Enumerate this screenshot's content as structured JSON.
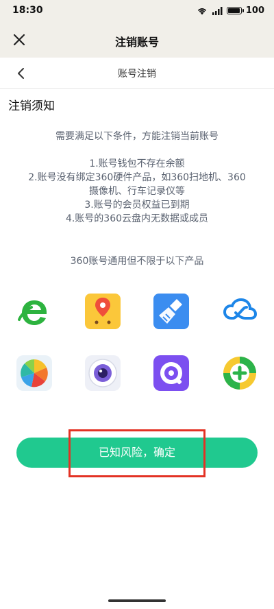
{
  "status_bar": {
    "time": "18:30",
    "battery": "100",
    "battery_level": 1.0,
    "icons": [
      "wifi-icon",
      "signal-icon",
      "battery-icon"
    ]
  },
  "title_bar": {
    "title": "注销账号",
    "close_icon": "close-icon"
  },
  "inner_nav": {
    "title": "账号注销",
    "back_icon": "chevron-left-icon"
  },
  "notice": {
    "section_title": "注销须知",
    "intro": "需要满足以下条件，方能注销当前账号",
    "conditions": [
      "1.账号钱包不存在余额",
      "2.账号没有绑定360硬件产品，如360扫地机、360",
      "摄像机、行车记录仪等",
      "3.账号的会员权益已到期",
      "4.账号的360云盘内无数据或成员"
    ],
    "products_intro": "360账号通用但不限于以下产品"
  },
  "products": [
    {
      "name": "browser-e-icon"
    },
    {
      "name": "map-pin-app-icon"
    },
    {
      "name": "broom-cleaner-icon"
    },
    {
      "name": "cloud-disk-icon"
    },
    {
      "name": "color-segment-app-icon"
    },
    {
      "name": "camera-app-icon"
    },
    {
      "name": "purple-ring-app-icon"
    },
    {
      "name": "security-plus-icon"
    }
  ],
  "confirm_button": {
    "label": "已知风险，确定"
  },
  "colors": {
    "accent": "#20c98f",
    "highlight": "#e33224",
    "header_bg": "#f1efe9",
    "notice_text": "#5a6270"
  }
}
